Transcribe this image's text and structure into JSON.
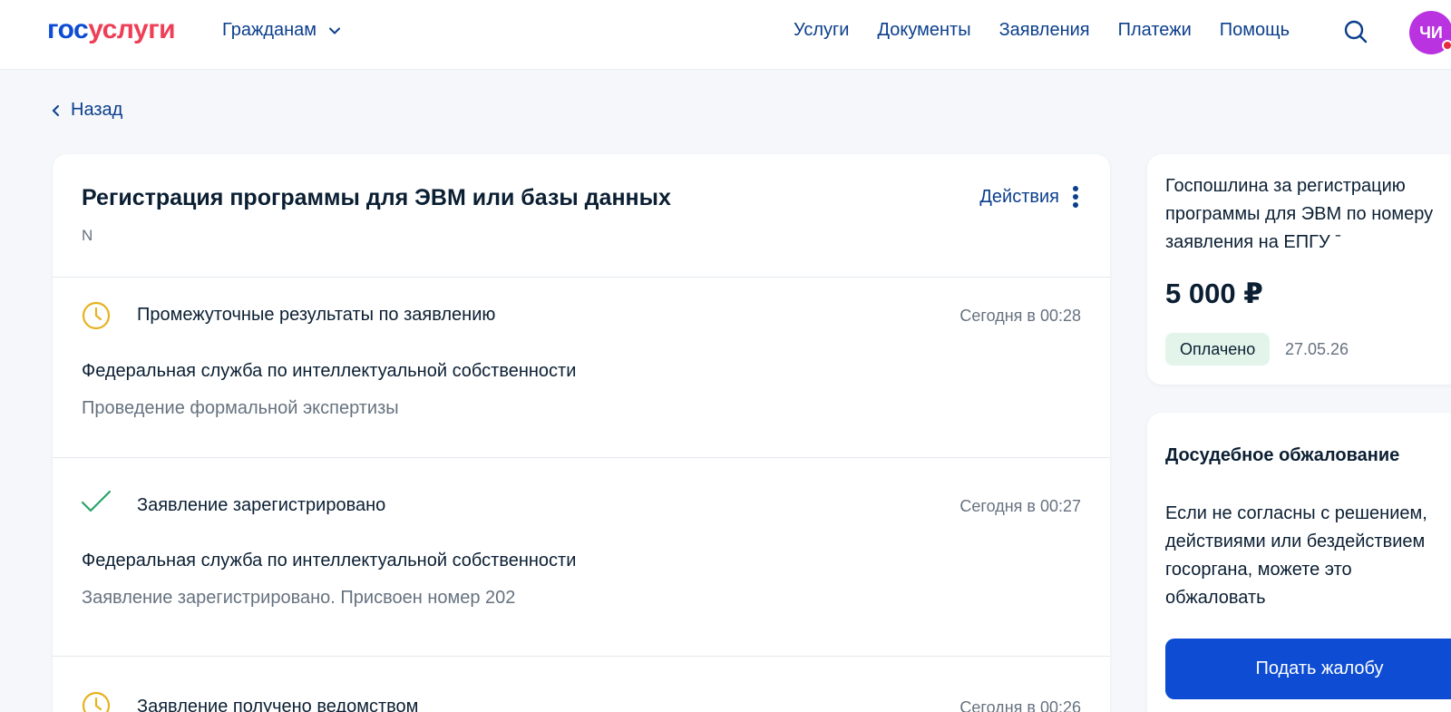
{
  "header": {
    "logo_part1": "гос",
    "logo_part2": "услуги",
    "audience": "Гражданам",
    "nav": [
      "Услуги",
      "Документы",
      "Заявления",
      "Платежи",
      "Помощь"
    ],
    "avatar_initials": "ЧИ"
  },
  "back_label": "Назад",
  "application": {
    "title": "Регистрация программы для ЭВМ или базы данных",
    "subtitle": "N",
    "actions_label": "Действия",
    "events": [
      {
        "icon": "clock-icon",
        "title": "Промежуточные результаты по заявлению",
        "time": "Сегодня в 00:28",
        "org": "Федеральная служба по интеллектуальной собственности",
        "desc": "Проведение формальной экспертизы"
      },
      {
        "icon": "check-icon",
        "title": "Заявление зарегистрировано",
        "time": "Сегодня в 00:27",
        "org": "Федеральная служба по интеллектуальной собственности",
        "desc": "Заявление зарегистрировано. Присвоен номер 202"
      },
      {
        "icon": "clock-icon",
        "title": "Заявление получено ведомством",
        "time": "Сегодня в 00:26"
      }
    ]
  },
  "fee": {
    "title": "Госпошлина за регистрацию программы для ЭВМ по номеру заявления на ЕПГУ ˉ",
    "amount": "5 000 ₽",
    "status": "Оплачено",
    "date": "27.05.26"
  },
  "appeal": {
    "title": "Досудебное обжалование",
    "text": "Если не согласны с решением, действиями или бездействием госоргана, можете это обжаловать",
    "button": "Подать жалобу"
  },
  "colors": {
    "brand_blue": "#0d4cd3",
    "brand_red": "#ee3f58",
    "link": "#0b3f8c",
    "clock": "#e6b320",
    "check": "#2ba36a"
  }
}
